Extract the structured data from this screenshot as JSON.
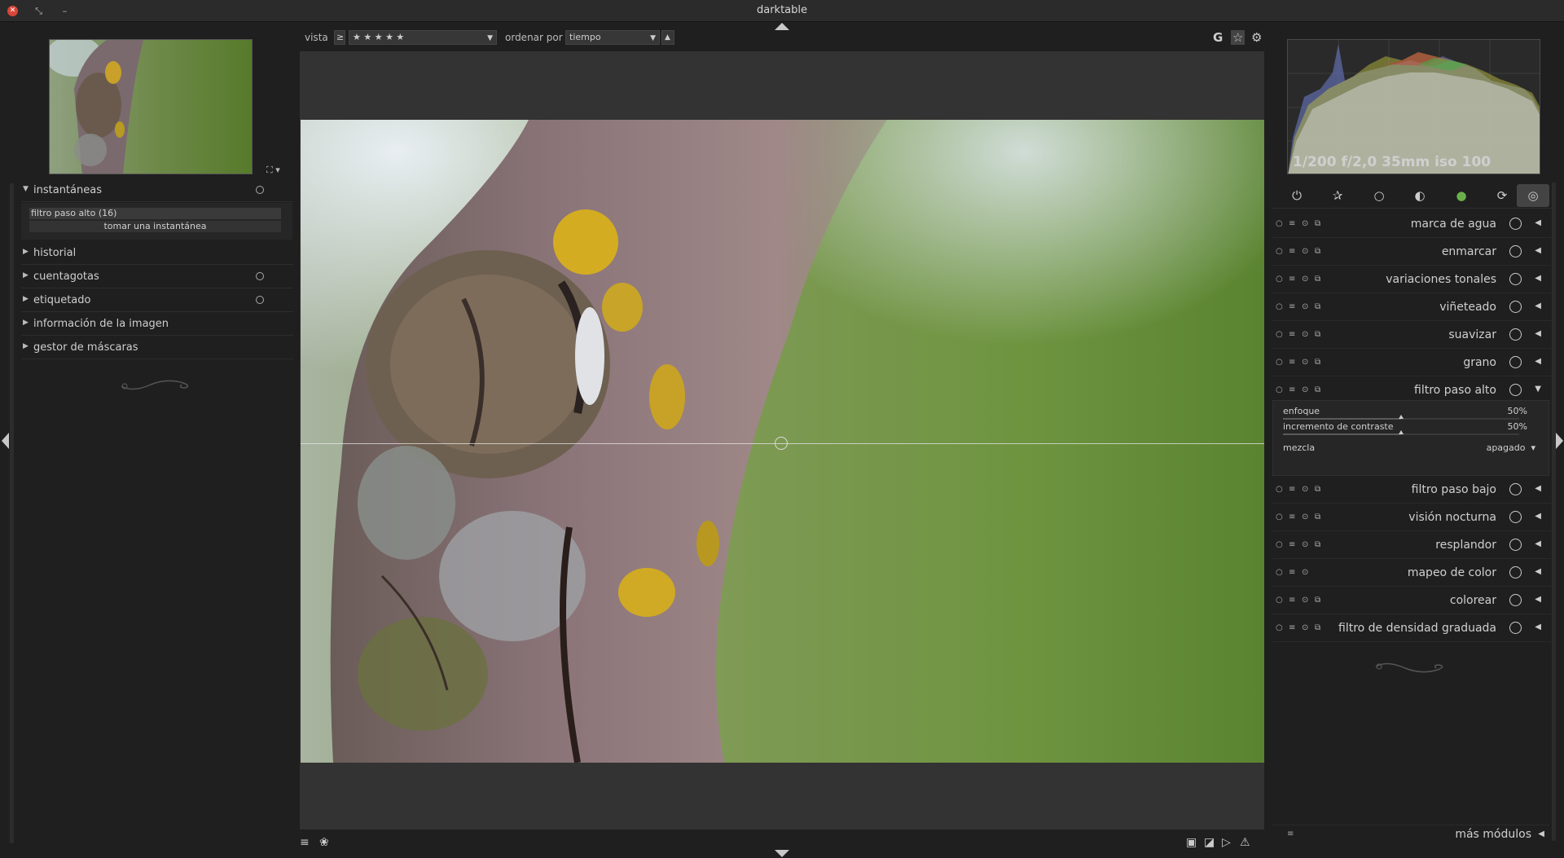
{
  "window": {
    "title": "darktable"
  },
  "navigator": {
    "zoom_icon": "fit-zoom-icon"
  },
  "left_panel": {
    "sections": [
      {
        "id": "instantaneas",
        "label": "instantáneas",
        "expanded": true,
        "reset": true
      },
      {
        "id": "historial",
        "label": "historial",
        "expanded": false,
        "reset": false
      },
      {
        "id": "cuentagotas",
        "label": "cuentagotas",
        "expanded": false,
        "reset": true
      },
      {
        "id": "etiquetado",
        "label": "etiquetado",
        "expanded": false,
        "reset": true
      },
      {
        "id": "informacion",
        "label": "información de la imagen",
        "expanded": false,
        "reset": false
      },
      {
        "id": "mascaras",
        "label": "gestor de máscaras",
        "expanded": false,
        "reset": false
      }
    ],
    "snapshots": {
      "item": "filtro paso alto (16)",
      "take_button": "tomar una instantánea"
    }
  },
  "top_bar": {
    "view_label": "vista",
    "comparator": "≥",
    "rating": "★ ★ ★ ★ ★",
    "sort_label": "ordenar por",
    "sort_value": "tiempo",
    "sort_dir": "▲",
    "grouping_icon": "G",
    "star_icon": "☆",
    "gear_icon": "⚙"
  },
  "histogram": {
    "info": "1/200 f/2,0 35mm iso 100",
    "colors": {
      "red": "#c84040",
      "green": "#4aa84a",
      "blue": "#4a5ad0"
    }
  },
  "module_groups": [
    "⏻",
    "✰",
    "○",
    "◐",
    "●",
    "⟳",
    "◎"
  ],
  "modules": [
    {
      "name": "marca de agua",
      "icon": "watermark-icon",
      "expanded": false
    },
    {
      "name": "enmarcar",
      "icon": "frame-icon",
      "expanded": false
    },
    {
      "name": "variaciones tonales",
      "icon": "split-toning-icon",
      "expanded": false
    },
    {
      "name": "viñeteado",
      "icon": "vignette-icon",
      "expanded": false
    },
    {
      "name": "suavizar",
      "icon": "soften-icon",
      "expanded": false
    },
    {
      "name": "grano",
      "icon": "grain-icon",
      "expanded": false
    },
    {
      "name": "filtro paso alto",
      "icon": "highpass-icon",
      "expanded": true
    },
    {
      "name": "filtro paso bajo",
      "icon": "lowpass-icon",
      "expanded": false
    },
    {
      "name": "visión nocturna",
      "icon": "lowlight-icon",
      "expanded": false
    },
    {
      "name": "resplandor",
      "icon": "bloom-icon",
      "expanded": false
    },
    {
      "name": "mapeo de color",
      "icon": "colormapping-icon",
      "expanded": false
    },
    {
      "name": "colorear",
      "icon": "colorize-icon",
      "expanded": false
    },
    {
      "name": "filtro de densidad graduada",
      "icon": "graduated-density-icon",
      "expanded": false
    }
  ],
  "highpass": {
    "sliders": [
      {
        "label": "enfoque",
        "value": "50%",
        "fraction": 0.5
      },
      {
        "label": "incremento de contraste",
        "value": "50%",
        "fraction": 0.5
      }
    ],
    "blend_label": "mezcla",
    "blend_value": "apagado"
  },
  "more_modules": {
    "label": "más módulos"
  },
  "bottom_bar": {
    "left_icons": [
      "menu-icon",
      "styles-icon"
    ],
    "right_icons": [
      "color-assessment-icon",
      "softproof-icon",
      "gamut-check-icon",
      "warning-icon"
    ]
  }
}
